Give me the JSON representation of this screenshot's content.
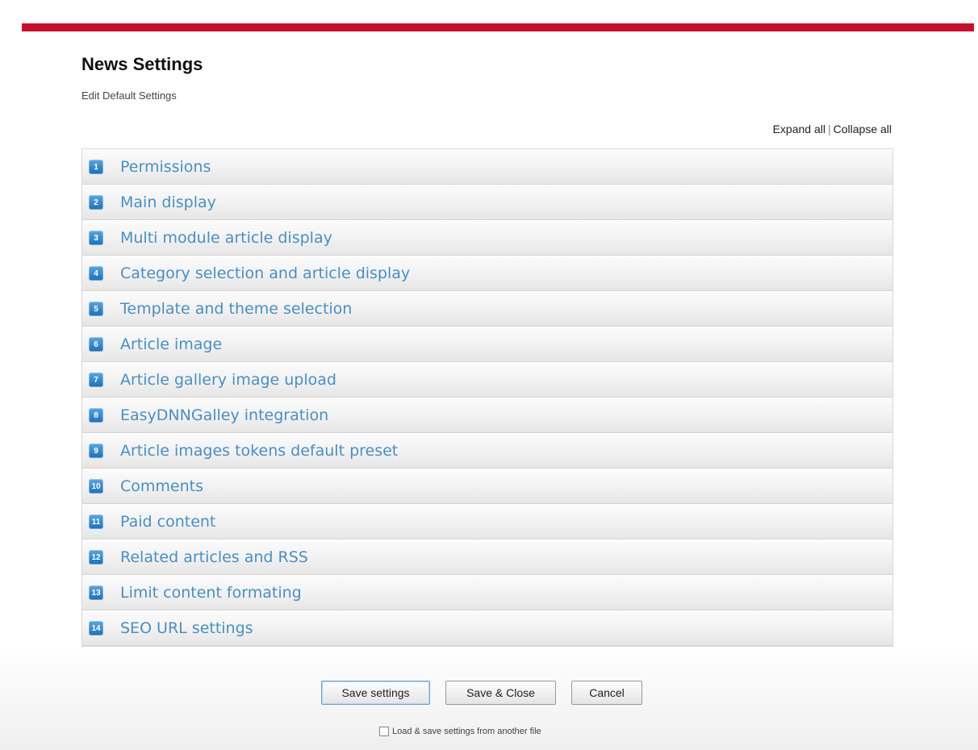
{
  "header": {
    "title": "News Settings",
    "subtitle": "Edit Default Settings"
  },
  "toggle_links": {
    "expand": "Expand all",
    "separator": "|",
    "collapse": "Collapse all"
  },
  "sections": [
    {
      "number": "1",
      "label": "Permissions"
    },
    {
      "number": "2",
      "label": "Main display"
    },
    {
      "number": "3",
      "label": "Multi module article display"
    },
    {
      "number": "4",
      "label": "Category selection and article display"
    },
    {
      "number": "5",
      "label": "Template and theme selection"
    },
    {
      "number": "6",
      "label": "Article image"
    },
    {
      "number": "7",
      "label": "Article gallery image upload"
    },
    {
      "number": "8",
      "label": "EasyDNNGalley integration"
    },
    {
      "number": "9",
      "label": "Article images tokens default preset"
    },
    {
      "number": "10",
      "label": "Comments"
    },
    {
      "number": "11",
      "label": "Paid content"
    },
    {
      "number": "12",
      "label": "Related articles and RSS"
    },
    {
      "number": "13",
      "label": "Limit content formating"
    },
    {
      "number": "14",
      "label": "SEO URL settings"
    }
  ],
  "actions": {
    "save": "Save settings",
    "save_close": "Save & Close",
    "cancel": "Cancel"
  },
  "file_option": {
    "label": "Load & save settings from another file",
    "checked": false
  },
  "colors": {
    "top_bar": "#c8102e",
    "section_label": "#4a8fc0",
    "badge": "#1e6fb4"
  }
}
